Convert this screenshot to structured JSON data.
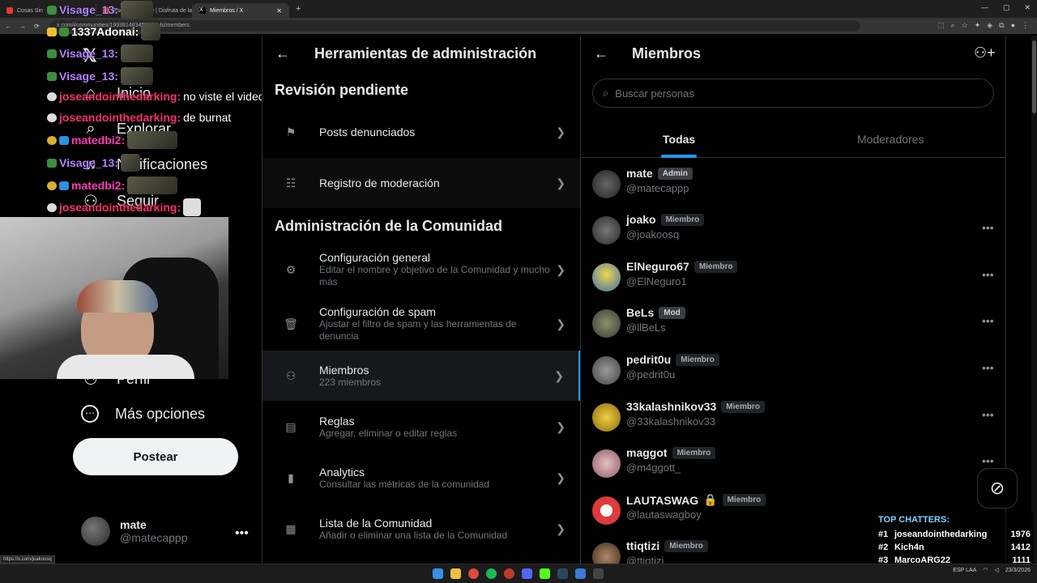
{
  "browser": {
    "tabs": [
      {
        "label": "Cosas Sin",
        "color": "#e23a2e"
      },
      {
        "label": "Escucha a mate | Disfruta de la",
        "color": "#e25a2e"
      },
      {
        "label": "Miembros / X",
        "color": "#ffffff"
      }
    ],
    "url": "x.com/i/communities/1993914834566/tools/members",
    "status_url": "https://x.com/joakoosq"
  },
  "chat_overlay": {
    "lines": [
      {
        "user": "Visage_13:",
        "color": "#b380ff",
        "msg": ""
      },
      {
        "user": "1337Adonai:",
        "color": "#ffffff",
        "msg": ""
      },
      {
        "user": "Visage_13:",
        "color": "#b380ff",
        "msg": ""
      },
      {
        "user": "Visage_13:",
        "color": "#b380ff",
        "msg": ""
      },
      {
        "user": "joseandointhedarking:",
        "color": "#ff2e6e",
        "msg": "no viste el video"
      },
      {
        "user": "joseandointhedarking:",
        "color": "#ff2e6e",
        "msg": "de burnat"
      },
      {
        "user": "matedbi2:",
        "color": "#ff3ab4",
        "msg": ""
      },
      {
        "user": "Visage_13:",
        "color": "#b380ff",
        "msg": ""
      },
      {
        "user": "matedbi2:",
        "color": "#ff3ab4",
        "msg": ""
      },
      {
        "user": "joseandointhedarking:",
        "color": "#ff2e6e",
        "msg": ""
      }
    ]
  },
  "left_nav": {
    "items": [
      {
        "label": "Inicio",
        "icon": "home-icon",
        "glyph": "⌂"
      },
      {
        "label": "Explorar",
        "icon": "search-icon",
        "glyph": "⌕"
      },
      {
        "label": "Notificaciones",
        "icon": "bell-icon",
        "glyph": "🔔"
      },
      {
        "label": "Seguir",
        "icon": "follow-icon",
        "glyph": "👤"
      },
      {
        "label": "Perfil",
        "icon": "profile-icon",
        "glyph": "👤"
      },
      {
        "label": "Más opciones",
        "icon": "more-options-icon",
        "glyph": "⋯"
      }
    ],
    "post_button": "Postear",
    "account": {
      "name": "mate",
      "handle": "@matecappp"
    }
  },
  "admin_tools": {
    "title": "Herramientas de administración",
    "section_pending": "Revisión pendiente",
    "pending_rows": [
      {
        "label": "Posts denunciados",
        "desc": "",
        "icon": "flag-icon"
      },
      {
        "label": "Registro de moderación",
        "desc": "",
        "icon": "moderation-log-icon"
      }
    ],
    "section_admin": "Administración de la Comunidad",
    "admin_rows": [
      {
        "label": "Configuración general",
        "desc": "Editar el nombre y objetivo de la Comunidad y mucho más",
        "icon": "gear-icon"
      },
      {
        "label": "Configuración de spam",
        "desc": "Ajustar el filtro de spam y las herramientas de denuncia",
        "icon": "trash-icon"
      },
      {
        "label": "Miembros",
        "desc": "223 miembros",
        "icon": "members-icon"
      },
      {
        "label": "Reglas",
        "desc": "Agregar, eliminar o editar reglas",
        "icon": "rules-icon"
      },
      {
        "label": "Analytics",
        "desc": "Consultar las métricas de la comunidad",
        "icon": "analytics-icon"
      },
      {
        "label": "Lista de la Comunidad",
        "desc": "Añadir o eliminar una lista de la Comunidad",
        "icon": "list-icon"
      }
    ]
  },
  "members_panel": {
    "title": "Miembros",
    "search_placeholder": "Buscar personas",
    "tabs": [
      "Todas",
      "Moderadores"
    ],
    "members": [
      {
        "name": "mate",
        "badge": "Admin",
        "handle": "@matecappp",
        "avatar": "#4a4a4a"
      },
      {
        "name": "joako",
        "badge": "Miembro",
        "handle": "@joakoosq",
        "avatar": "#5a5a5a"
      },
      {
        "name": "ElNeguro67",
        "badge": "Miembro",
        "handle": "@ElNeguro1",
        "avatar": "#d9c23a"
      },
      {
        "name": "BeLs",
        "badge": "Mod",
        "handle": "@llBeLs",
        "avatar": "#6a6f5a"
      },
      {
        "name": "pedrit0u",
        "badge": "Miembro",
        "handle": "@pedrit0u",
        "avatar": "#7a7a7a"
      },
      {
        "name": "33kalashnikov33",
        "badge": "Miembro",
        "handle": "@33kalashnikov33",
        "avatar": "#d6b02a"
      },
      {
        "name": "maggot",
        "badge": "Miembro",
        "handle": "@m4ggott_",
        "avatar": "#c9a0a0"
      },
      {
        "name": "LAUTASWAG",
        "badge": "Miembro",
        "handle": "@lautaswagboy",
        "avatar": "#e03a3a"
      },
      {
        "name": "ttiqtizi",
        "badge": "Miembro",
        "handle": "@ttiqtizi",
        "avatar": "#8a6a4a"
      }
    ]
  },
  "top_chatters": {
    "title": "TOP CHATTERS:",
    "rows": [
      {
        "rank": "#1",
        "name": "joseandointhedarking",
        "count": "1976"
      },
      {
        "rank": "#2",
        "name": "Kich4n",
        "count": "1412"
      },
      {
        "rank": "#3",
        "name": "MarcoARG22",
        "count": "1111"
      }
    ]
  },
  "taskbar": {
    "lang": "ESP LAA",
    "time": "23/3/2026"
  }
}
